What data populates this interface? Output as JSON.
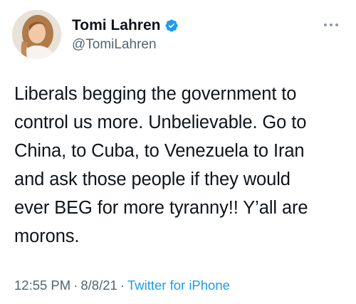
{
  "author": {
    "display_name": "Tomi Lahren",
    "handle": "@TomiLahren",
    "verified_icon": "verified-badge-icon",
    "verified_color": "#1d9bf0"
  },
  "tweet": {
    "text": "Liberals begging the government to\ncontrol us more. Unbelievable. Go to\nChina, to Cuba, to Venezuela to Iran\nand ask those people if they would\never BEG for more tyranny!! Y’all are\nmorons."
  },
  "meta": {
    "time": "12:55 PM",
    "separator": "·",
    "date": "8/8/21",
    "source": "Twitter for iPhone",
    "source_color": "#1d9bf0"
  },
  "menu": {
    "icon": "more-options-icon"
  }
}
